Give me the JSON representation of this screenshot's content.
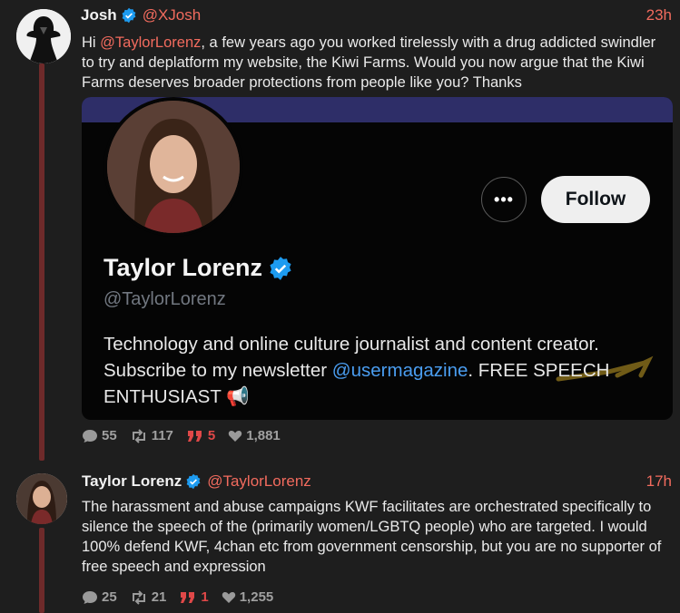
{
  "post1": {
    "name": "Josh",
    "handle": "@XJosh",
    "time": "23h",
    "text_prefix": "Hi ",
    "mention": "@TaylorLorenz",
    "text_rest": ", a few years ago you worked tirelessly with a drug addicted swindler to try and deplatform my website, the Kiwi Farms. Would you now argue that the Kiwi Farms deserves broader protections from people like you? Thanks",
    "replies": "55",
    "reposts": "117",
    "quotes": "5",
    "likes": "1,881"
  },
  "embed": {
    "more_label": "•••",
    "follow_label": "Follow",
    "name": "Taylor Lorenz",
    "handle": "@TaylorLorenz",
    "bio_part1": "Technology and online culture journalist and content creator. Subscribe to my newsletter ",
    "bio_link": "@usermagazine",
    "bio_part2": ". FREE SPEECH ENTHUSIAST",
    "bio_emoji": "📢"
  },
  "post2": {
    "name": "Taylor Lorenz",
    "handle": "@TaylorLorenz",
    "time": "17h",
    "text": "The harassment and abuse campaigns KWF facilitates are orchestrated specifically to silence the speech of the (primarily women/LGBTQ people) who are targeted. I would 100% defend KWF, 4chan etc from government censorship, but you are no supporter of free speech and expression",
    "replies": "25",
    "reposts": "21",
    "quotes": "1",
    "likes": "1,255"
  },
  "colors": {
    "accent": "#f26b5e",
    "thread_line": "#6e2a2a",
    "verified": "#1d9bf0",
    "link": "#4a9df0"
  },
  "icons": [
    "verified-badge-icon",
    "comment-icon",
    "repost-icon",
    "quote-icon",
    "heart-icon",
    "megaphone-icon"
  ]
}
